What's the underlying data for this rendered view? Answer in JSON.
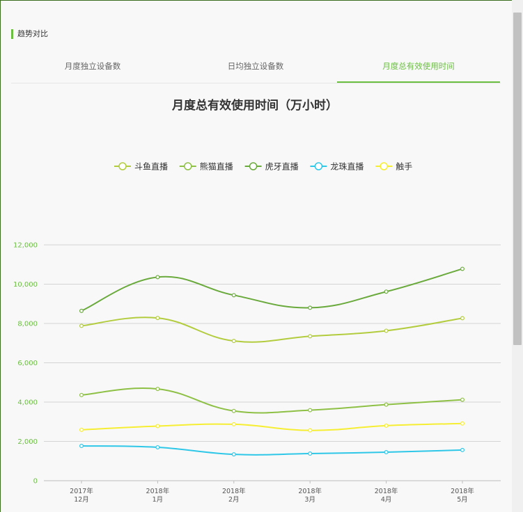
{
  "section_title": "趋势对比",
  "tabs": [
    {
      "label": "月度独立设备数",
      "active": false
    },
    {
      "label": "日均独立设备数",
      "active": false
    },
    {
      "label": "月度总有效使用时间",
      "active": true
    }
  ],
  "colors": {
    "accent": "#6abf40"
  },
  "chart_data": {
    "type": "line",
    "title": "月度总有效使用时间（万小时）",
    "categories": [
      "2017年\n12月",
      "2018年\n1月",
      "2018年\n2月",
      "2018年\n3月",
      "2018年\n4月",
      "2018年\n5月"
    ],
    "ylim": [
      0,
      12000
    ],
    "yticks": [
      0,
      2000,
      4000,
      6000,
      8000,
      10000,
      12000
    ],
    "ytick_labels": [
      "0",
      "2,000",
      "4,000",
      "6,000",
      "8,000",
      "10,000",
      "12,000"
    ],
    "grid": true,
    "legend_position": "top",
    "series": [
      {
        "name": "斗鱼直播",
        "color": "#b2cc3e",
        "values": [
          7880,
          8280,
          7110,
          7350,
          7630,
          8270
        ]
      },
      {
        "name": "熊猫直播",
        "color": "#8dc044",
        "values": [
          4360,
          4670,
          3550,
          3590,
          3870,
          4120
        ]
      },
      {
        "name": "虎牙直播",
        "color": "#6aaa3c",
        "values": [
          8640,
          10360,
          9440,
          8800,
          9620,
          10780
        ]
      },
      {
        "name": "龙珠直播",
        "color": "#2ec7e8",
        "values": [
          1770,
          1700,
          1340,
          1380,
          1450,
          1560
        ]
      },
      {
        "name": "触手",
        "color": "#f6ee32",
        "values": [
          2590,
          2780,
          2870,
          2560,
          2800,
          2910
        ]
      }
    ]
  }
}
